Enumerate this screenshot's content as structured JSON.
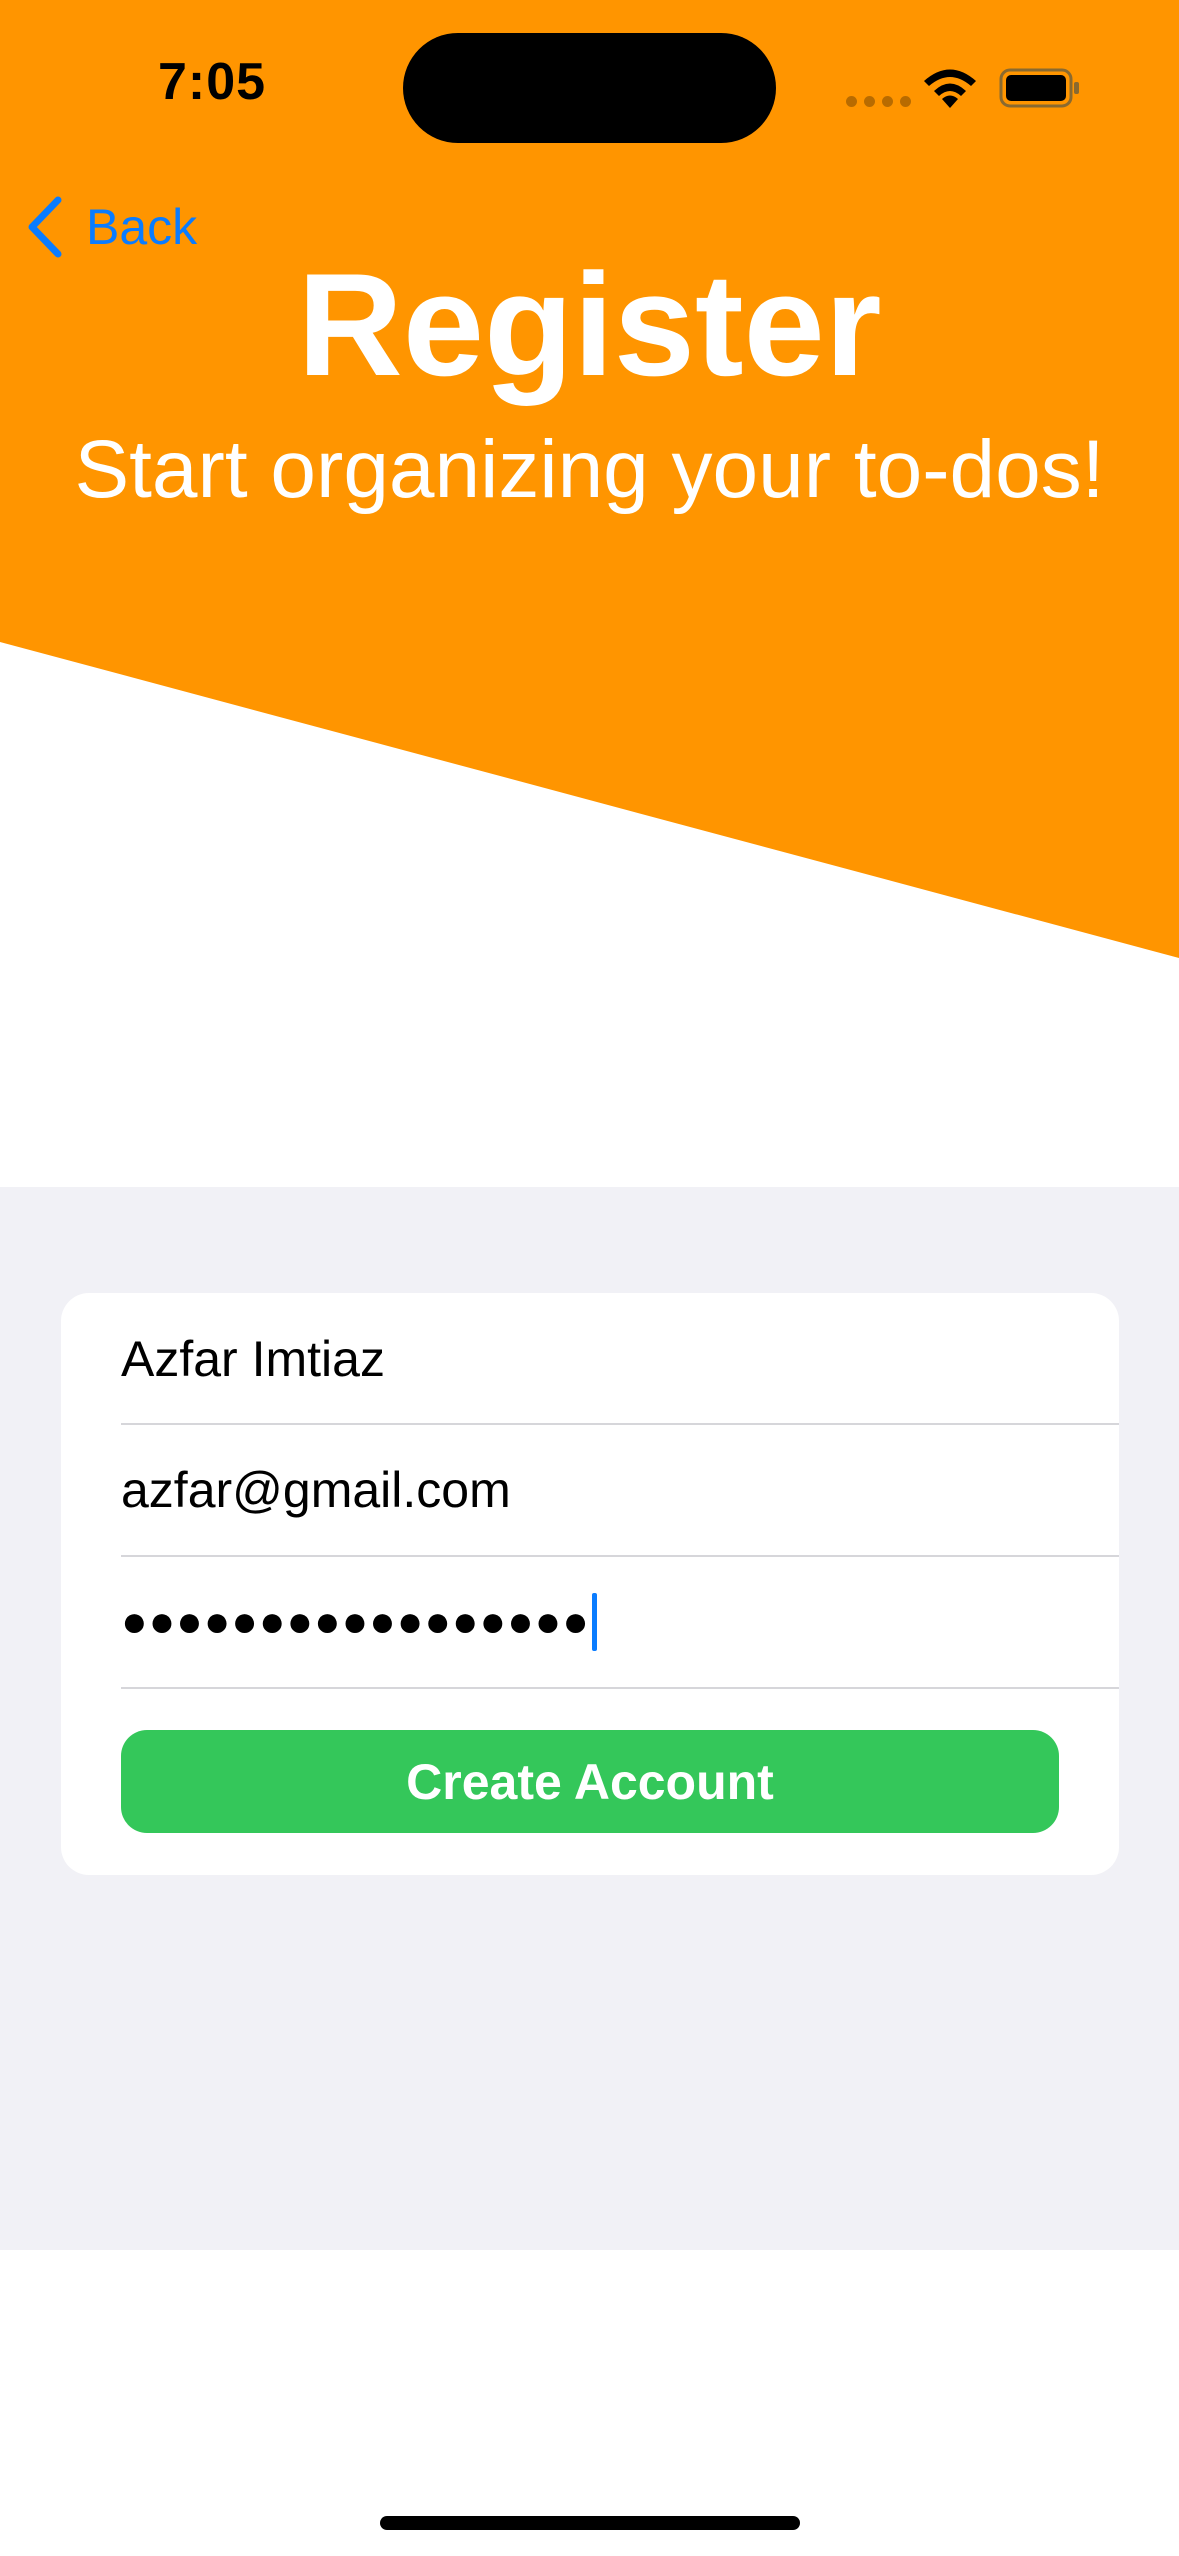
{
  "status_bar": {
    "time": "7:05"
  },
  "nav": {
    "back_label": "Back",
    "back_icon": "chevron-left-icon"
  },
  "header": {
    "title": "Register",
    "subtitle": "Start organizing your to-dos!",
    "background_color": "#ff9500"
  },
  "form": {
    "name_value": "Azfar Imtiaz",
    "email_value": "azfar@gmail.com",
    "password_masked": "●●●●●●●●●●●●●●●●●",
    "create_button_label": "Create Account",
    "button_color": "#34c75a"
  },
  "colors": {
    "accent_blue": "#0a7cff",
    "form_background": "#f1f1f6"
  }
}
